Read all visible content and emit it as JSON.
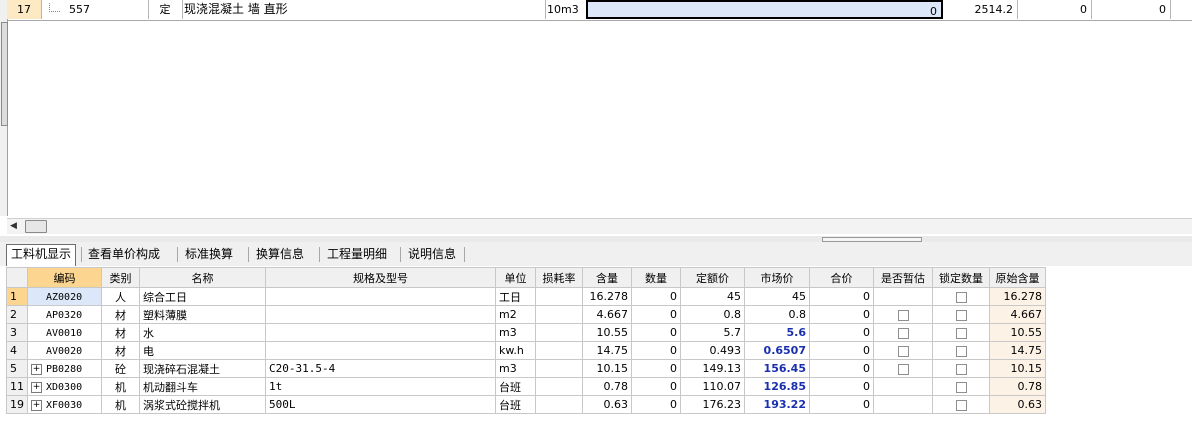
{
  "top_row": {
    "row_number": "17",
    "code": "557",
    "type": "定",
    "name": "现浇混凝土 墙 直形",
    "unit": "10m3",
    "quantity": "0",
    "unit_price": "2514.2",
    "col_a": "0",
    "col_b": "0"
  },
  "tabs": [
    {
      "label": "工料机显示"
    },
    {
      "label": "查看单价构成"
    },
    {
      "label": "标准换算"
    },
    {
      "label": "换算信息"
    },
    {
      "label": "工程量明细"
    },
    {
      "label": "说明信息"
    }
  ],
  "grid": {
    "headers": [
      "编码",
      "类别",
      "名称",
      "规格及型号",
      "单位",
      "损耗率",
      "含量",
      "数量",
      "定额价",
      "市场价",
      "合价",
      "是否暂估",
      "锁定数量",
      "原始含量"
    ],
    "rows": [
      {
        "rn": "1",
        "code": "AZ0020",
        "type": "人",
        "name": "综合工日",
        "spec": "",
        "unit": "工日",
        "loss": "",
        "content": "16.278",
        "qty": "0",
        "quota": "45",
        "market": "45",
        "total": "0",
        "orig": "16.278"
      },
      {
        "rn": "2",
        "code": "AP0320",
        "type": "材",
        "name": "塑料薄膜",
        "spec": "",
        "unit": "m2",
        "loss": "",
        "content": "4.667",
        "qty": "0",
        "quota": "0.8",
        "market": "0.8",
        "total": "0",
        "orig": "4.667"
      },
      {
        "rn": "3",
        "code": "AV0010",
        "type": "材",
        "name": "水",
        "spec": "",
        "unit": "m3",
        "loss": "",
        "content": "10.55",
        "qty": "0",
        "quota": "5.7",
        "market": "5.6",
        "total": "0",
        "orig": "10.55"
      },
      {
        "rn": "4",
        "code": "AV0020",
        "type": "材",
        "name": "电",
        "spec": "",
        "unit": "kw.h",
        "loss": "",
        "content": "14.75",
        "qty": "0",
        "quota": "0.493",
        "market": "0.6507",
        "total": "0",
        "orig": "14.75"
      },
      {
        "rn": "5",
        "code": "PB0280",
        "type": "砼",
        "name": "现浇碎石混凝土",
        "spec": "C20-31.5-4",
        "unit": "m3",
        "loss": "",
        "content": "10.15",
        "qty": "0",
        "quota": "149.13",
        "market": "156.45",
        "total": "0",
        "orig": "10.15"
      },
      {
        "rn": "11",
        "code": "XD0300",
        "type": "机",
        "name": "机动翻斗车",
        "spec": "1t",
        "unit": "台班",
        "loss": "",
        "content": "0.78",
        "qty": "0",
        "quota": "110.07",
        "market": "126.85",
        "total": "0",
        "orig": "0.78"
      },
      {
        "rn": "19",
        "code": "XF0030",
        "type": "机",
        "name": "涡浆式砼搅拌机",
        "spec": "500L",
        "unit": "台班",
        "loss": "",
        "content": "0.63",
        "qty": "0",
        "quota": "176.23",
        "market": "193.22",
        "total": "0",
        "orig": "0.63"
      }
    ]
  },
  "colors": {
    "accent": "#fcd691",
    "selection": "#dce8fa",
    "market_price": "#1a2fb0"
  }
}
